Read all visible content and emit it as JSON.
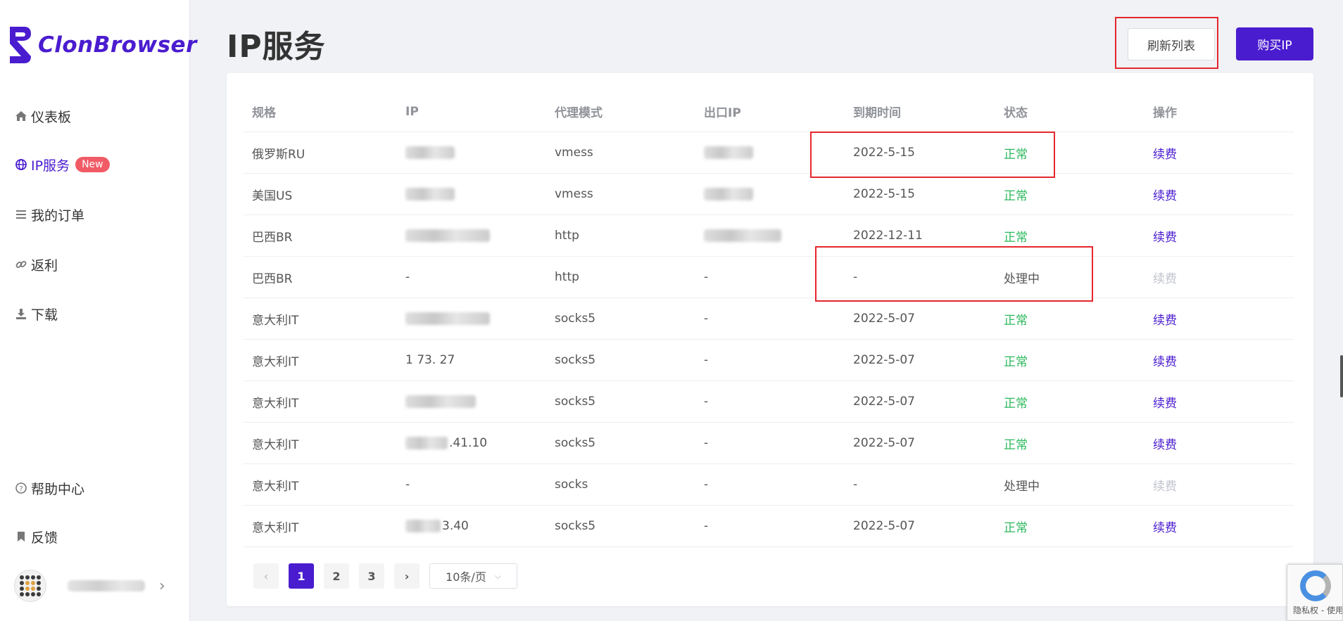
{
  "sidebar": {
    "brand": "ClonBrowser",
    "items": [
      {
        "label": "仪表板",
        "icon": "home-icon"
      },
      {
        "label": "IP服务",
        "icon": "globe-icon",
        "badge": "New",
        "active": true
      },
      {
        "label": "我的订单",
        "icon": "list-icon"
      },
      {
        "label": "返利",
        "icon": "link-icon"
      },
      {
        "label": "下载",
        "icon": "download-icon"
      }
    ],
    "bottom_items": [
      {
        "label": "帮助中心",
        "icon": "help-icon"
      },
      {
        "label": "反馈",
        "icon": "bookmark-icon"
      }
    ]
  },
  "header": {
    "title": "IP服务",
    "refresh_label": "刷新列表",
    "buy_label": "购买IP"
  },
  "table": {
    "columns": [
      "规格",
      "IP",
      "代理模式",
      "出口IP",
      "到期时间",
      "状态",
      "操作"
    ],
    "rows": [
      {
        "spec": "俄罗斯RU",
        "ip": "",
        "mode": "vmess",
        "exit_ip": "",
        "expiry": "2022-5-15",
        "status": "正常",
        "action": "续费"
      },
      {
        "spec": "美国US",
        "ip": "",
        "mode": "vmess",
        "exit_ip": "",
        "expiry": "2022-5-15",
        "status": "正常",
        "action": "续费"
      },
      {
        "spec": "巴西BR",
        "ip": "",
        "mode": "http",
        "exit_ip": "",
        "expiry": "2022-12-11",
        "status": "正常",
        "action": "续费"
      },
      {
        "spec": "巴西BR",
        "ip": "-",
        "mode": "http",
        "exit_ip": "-",
        "expiry": "-",
        "status": "处理中",
        "action": "续费"
      },
      {
        "spec": "意大利IT",
        "ip": "",
        "mode": "socks5",
        "exit_ip": "-",
        "expiry": "2022-5-07",
        "status": "正常",
        "action": "续费"
      },
      {
        "spec": "意大利IT",
        "ip": "1     73.   27",
        "mode": "socks5",
        "exit_ip": "-",
        "expiry": "2022-5-07",
        "status": "正常",
        "action": "续费"
      },
      {
        "spec": "意大利IT",
        "ip": "",
        "mode": "socks5",
        "exit_ip": "-",
        "expiry": "2022-5-07",
        "status": "正常",
        "action": "续费"
      },
      {
        "spec": "意大利IT",
        "ip": ".41.10",
        "mode": "socks5",
        "exit_ip": "-",
        "expiry": "2022-5-07",
        "status": "正常",
        "action": "续费"
      },
      {
        "spec": "意大利IT",
        "ip": "-",
        "mode": "socks",
        "exit_ip": "-",
        "expiry": "-",
        "status": "处理中",
        "action": "续费"
      },
      {
        "spec": "意大利IT",
        "ip": "3.40",
        "mode": "socks5",
        "exit_ip": "-",
        "expiry": "2022-5-07",
        "status": "正常",
        "action": "续费"
      }
    ]
  },
  "pagination": {
    "pages": [
      "1",
      "2",
      "3"
    ],
    "current": "1",
    "prev": "‹",
    "next": "›",
    "page_size": "10条/页"
  },
  "recaptcha": {
    "text": "隐私权 - 使用条款"
  },
  "colors": {
    "accent": "#4a1ccf",
    "ok": "#2bb85c",
    "highlight": "#e5272d",
    "badge": "#f05b66"
  }
}
